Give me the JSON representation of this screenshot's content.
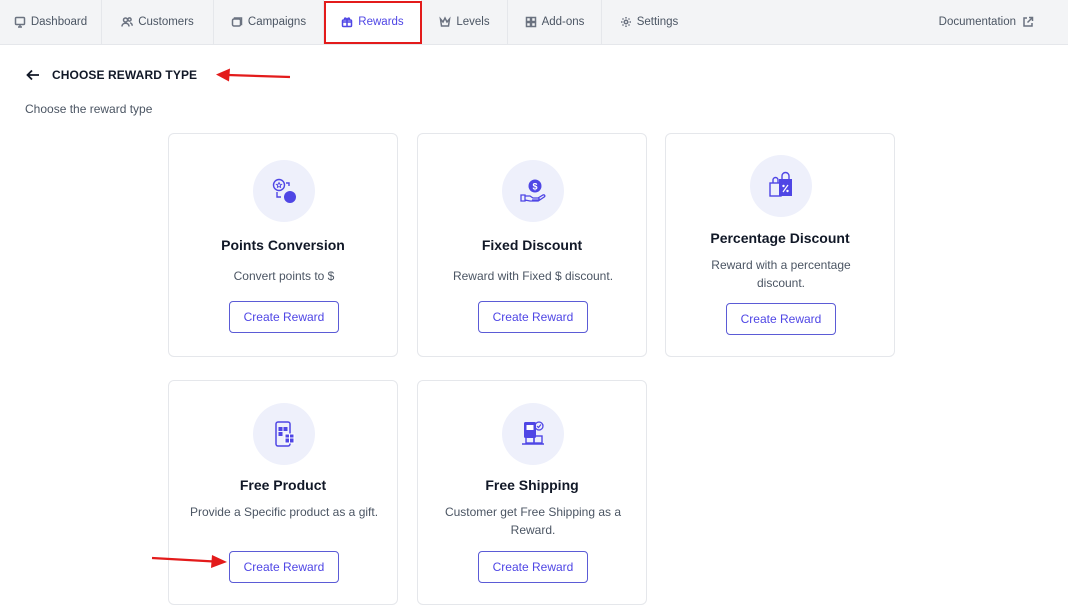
{
  "nav": {
    "tabs": [
      {
        "label": "Dashboard",
        "icon": "dashboard-icon"
      },
      {
        "label": "Customers",
        "icon": "customers-icon"
      },
      {
        "label": "Campaigns",
        "icon": "campaigns-icon"
      },
      {
        "label": "Rewards",
        "icon": "rewards-icon",
        "active": true
      },
      {
        "label": "Levels",
        "icon": "levels-icon"
      },
      {
        "label": "Add-ons",
        "icon": "addons-icon"
      },
      {
        "label": "Settings",
        "icon": "settings-icon"
      }
    ],
    "documentation": "Documentation"
  },
  "header": {
    "title": "CHOOSE REWARD TYPE",
    "subtitle": "Choose the reward type"
  },
  "cards": [
    {
      "title": "Points Conversion",
      "description": "Convert points to $",
      "button": "Create Reward",
      "icon": "points-conversion-icon"
    },
    {
      "title": "Fixed Discount",
      "description": "Reward with Fixed $ discount.",
      "button": "Create Reward",
      "icon": "fixed-discount-icon"
    },
    {
      "title": "Percentage Discount",
      "description": "Reward with a percentage discount.",
      "button": "Create Reward",
      "icon": "percentage-discount-icon"
    },
    {
      "title": "Free Product",
      "description": "Provide a Specific product as a gift.",
      "button": "Create Reward",
      "icon": "free-product-icon"
    },
    {
      "title": "Free Shipping",
      "description": "Customer get Free Shipping as a Reward.",
      "button": "Create Reward",
      "icon": "free-shipping-icon"
    }
  ],
  "colors": {
    "accent": "#4f46e5",
    "annotation": "#e31b1b",
    "icon_bg": "#eef0fb"
  }
}
